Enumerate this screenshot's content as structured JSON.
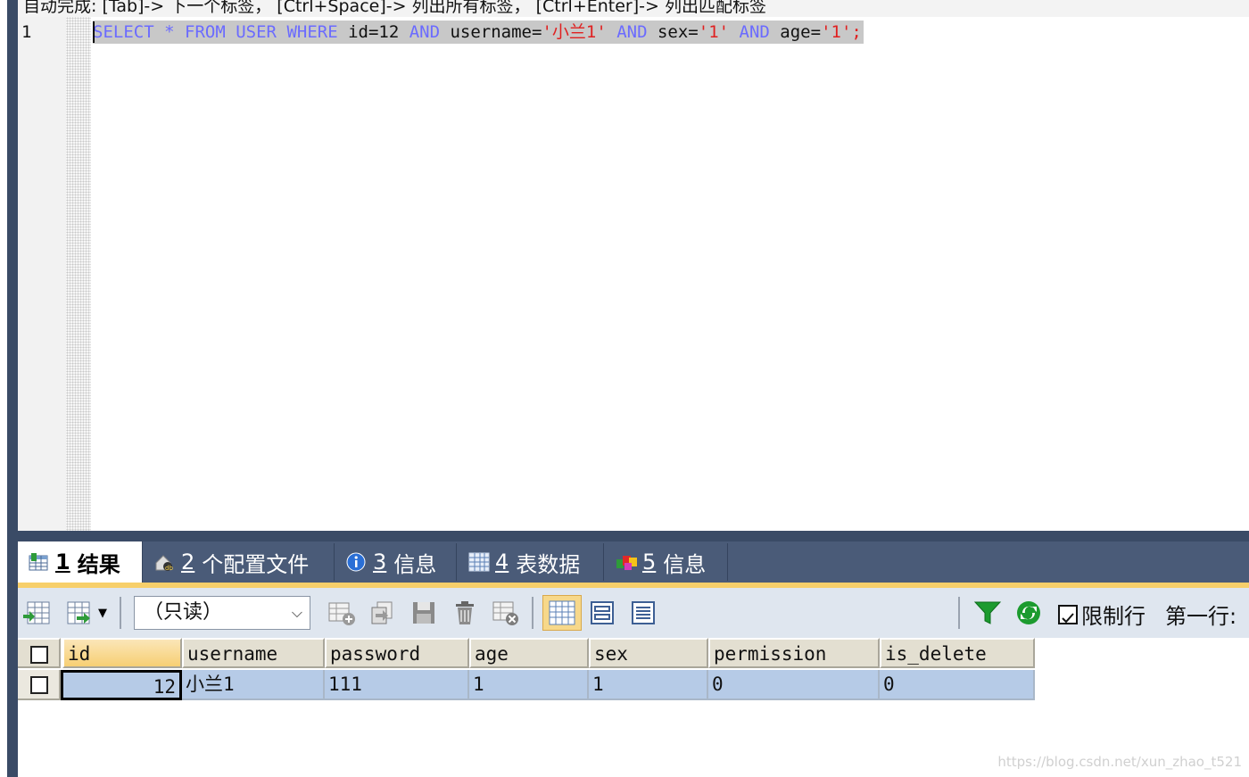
{
  "hint": "自动完成: [Tab]-> 下一个标签， [Ctrl+Space]-> 列出所有标签， [Ctrl+Enter]-> 列出匹配标签",
  "editor": {
    "line_number": "1",
    "tokens": [
      {
        "text": "SELECT",
        "type": "kw"
      },
      {
        "text": " ",
        "type": "plain"
      },
      {
        "text": "*",
        "type": "kw"
      },
      {
        "text": " ",
        "type": "plain"
      },
      {
        "text": "FROM",
        "type": "kw"
      },
      {
        "text": " ",
        "type": "plain"
      },
      {
        "text": "USER",
        "type": "kw"
      },
      {
        "text": " ",
        "type": "plain"
      },
      {
        "text": "WHERE",
        "type": "kw"
      },
      {
        "text": " id=12 ",
        "type": "plain"
      },
      {
        "text": "AND",
        "type": "kw"
      },
      {
        "text": " username=",
        "type": "plain"
      },
      {
        "text": "'小兰1'",
        "type": "str"
      },
      {
        "text": " ",
        "type": "plain"
      },
      {
        "text": "AND",
        "type": "kw"
      },
      {
        "text": " sex=",
        "type": "plain"
      },
      {
        "text": "'1'",
        "type": "str"
      },
      {
        "text": " ",
        "type": "plain"
      },
      {
        "text": "AND",
        "type": "kw"
      },
      {
        "text": " age=",
        "type": "plain"
      },
      {
        "text": "'1'",
        "type": "str"
      },
      {
        "text": ";",
        "type": "str"
      }
    ]
  },
  "tabs": [
    {
      "num": "1",
      "label": "结果",
      "icon": "result-table-icon"
    },
    {
      "num": "2",
      "label": "个配置文件",
      "icon": "profile-icon"
    },
    {
      "num": "3",
      "label": "信息",
      "icon": "info-icon"
    },
    {
      "num": "4",
      "label": "表数据",
      "icon": "table-data-icon"
    },
    {
      "num": "5",
      "label": "信息",
      "icon": "info-blocks-icon"
    }
  ],
  "toolbar": {
    "mode": "（只读）",
    "limit_label": "限制行",
    "limit_checked": true,
    "first_row_label": "第一行:"
  },
  "grid": {
    "columns": [
      "id",
      "username",
      "password",
      "age",
      "sex",
      "permission",
      "is_delete"
    ],
    "rows": [
      [
        "12",
        "小兰1",
        "111",
        "1",
        "1",
        "0",
        "0"
      ]
    ]
  },
  "watermark": "https://blog.csdn.net/xun_zhao_t521",
  "colors": {
    "keyword": "#6b6bff",
    "string": "#e02020",
    "selection": "#c8c8c8",
    "tabbar": "#4a5b78",
    "row_selected": "#b6cbe7",
    "header_accent": "#f7cf73"
  }
}
